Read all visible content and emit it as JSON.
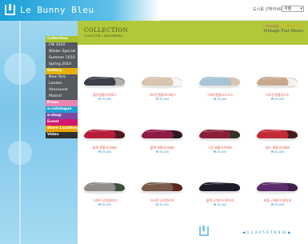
{
  "brand": {
    "name": "Le Bunny Bleu"
  },
  "header": {
    "city_label": "도시를 선택하세요",
    "city_value": "서울"
  },
  "nav": {
    "collection": "Collection",
    "collection_items": [
      "FW 2010",
      "Winter Special",
      "Summer 2010",
      "Spring 2010"
    ],
    "gallery": "Gallery",
    "gallery_items": [
      "New York",
      "London",
      "Vancouver",
      "Madrid"
    ],
    "press": "Press",
    "ecatalogue": "e-catalogue",
    "eshop": "e-shop",
    "event": "Event",
    "store": "Store Location",
    "video": "Video"
  },
  "banner": {
    "title": "COLLECTION",
    "breadcrumb": "COLLECTION > NEW ARRIVALS",
    "promo_line1_a": "Lovely",
    "promo_line1_b": "& romantic",
    "promo_line2": "Vintage Flat Shoes"
  },
  "products": [
    {
      "name": "블루젠틀리자패그",
      "price": "₩ 39,000",
      "color": "#3b3f4a",
      "toe": "#c8c2b8"
    },
    {
      "name": "브라운젠틀리자패그",
      "price": "₩ 39,000",
      "color": "#d9c4ad",
      "toe": "#ffffff"
    },
    {
      "name": "그레이젠틀리드도드",
      "price": "₩ 39,000",
      "color": "#a7c3d6",
      "toe": "#e2c6a8"
    },
    {
      "name": "브라운젠틀리드도",
      "price": "₩ 39,000",
      "color": "#c9a98e",
      "toe": "#ffffff"
    },
    {
      "name": "블랙 젠틀리자패프",
      "price": "₩ 45,000",
      "color": "#b71d3a",
      "toe": "#3a1a1a"
    },
    {
      "name": "블랙 젠틀리자패프",
      "price": "₩ 45,000",
      "color": "#8e1a47",
      "toe": "#1a1a1a"
    },
    {
      "name": "그린 젠틀리자패프",
      "price": "₩ 45,000",
      "color": "#8a1f3a",
      "toe": "#1e3a1f"
    },
    {
      "name": "레드 젠틀리자패프",
      "price": "₩ 45,000",
      "color": "#c22a36",
      "toe": "#2a1a1a"
    },
    {
      "name": "그레이 공업젠리즈",
      "price": "₩ 39,000",
      "color": "#8f8c8a",
      "toe": "#2d4a2a"
    },
    {
      "name": "브라운 공업젠리즈",
      "price": "₩ 39,000",
      "color": "#7a5a4a",
      "toe": "#5a1a1a"
    },
    {
      "name": "블랙 스웨이드젠더약",
      "price": "₩ 39,000",
      "color": "#1e1b2a",
      "toe": "#1e1b2a"
    },
    {
      "name": "퍼플 스웨이드젠더약",
      "price": "₩ 39,000",
      "color": "#5c2d6e",
      "toe": "#3d1d4a"
    }
  ],
  "pager": {
    "prev": "◀",
    "pages": [
      "1",
      "2",
      "3",
      "4",
      "5",
      "6",
      "7",
      "8",
      "9",
      "10"
    ],
    "next": "▶"
  }
}
